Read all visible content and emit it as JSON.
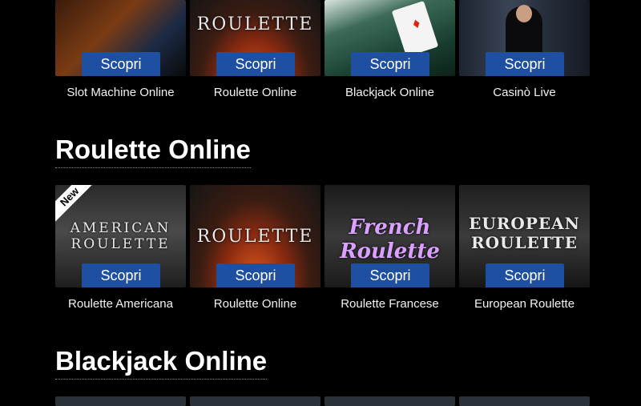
{
  "cta_label": "Scopri",
  "top_row": [
    "Slot Machine Online",
    "Roulette Online",
    "Blackjack Online",
    "Casinò Live"
  ],
  "top_thumb_texts": [
    "",
    "ROULETTE",
    "",
    ""
  ],
  "section1": {
    "title": "Roulette Online",
    "badge": "New",
    "items": [
      {
        "label": "Roulette Americana",
        "thumb_text": "AMERICAN ROULETTE"
      },
      {
        "label": "Roulette Online",
        "thumb_text": "ROULETTE"
      },
      {
        "label": "Roulette Francese",
        "thumb_text": "French Roulette"
      },
      {
        "label": "European Roulette",
        "thumb_text": "EUROPEAN ROULETTE"
      }
    ]
  },
  "section2": {
    "title": "Blackjack Online"
  },
  "colors": {
    "background": "#000000",
    "button": "#1e4fa0"
  }
}
